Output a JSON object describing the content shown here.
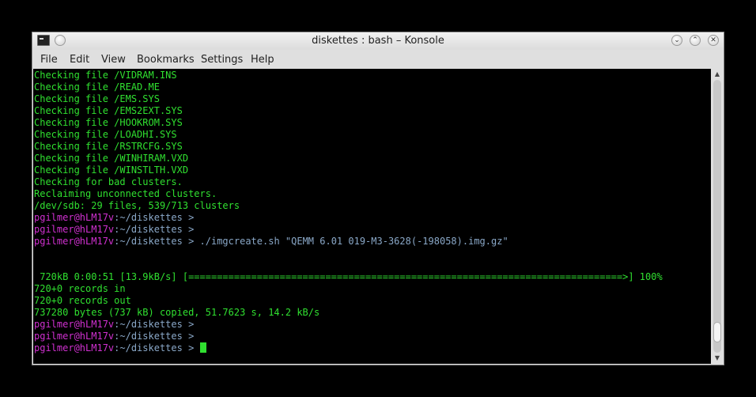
{
  "window": {
    "title": "diskettes : bash – Konsole",
    "controls": [
      "minimize-icon",
      "maximize-icon",
      "close-icon"
    ],
    "keep_above_icon": "circle-icon"
  },
  "menubar": {
    "items": [
      "File",
      "Edit",
      "View",
      "Bookmarks",
      "Settings",
      "Help"
    ]
  },
  "colors": {
    "output": "#30e030",
    "prompt_user": "#d030d0",
    "prompt_path": "#8aa8c8",
    "background": "#000000"
  },
  "terminal": {
    "lines": [
      {
        "text": "Checking file /VIDRAM.INS"
      },
      {
        "text": "Checking file /READ.ME"
      },
      {
        "text": "Checking file /EMS.SYS"
      },
      {
        "text": "Checking file /EMS2EXT.SYS"
      },
      {
        "text": "Checking file /HOOKROM.SYS"
      },
      {
        "text": "Checking file /LOADHI.SYS"
      },
      {
        "text": "Checking file /RSTRCFG.SYS"
      },
      {
        "text": "Checking file /WINHIRAM.VXD"
      },
      {
        "text": "Checking file /WINSTLTH.VXD"
      },
      {
        "text": "Checking for bad clusters."
      },
      {
        "text": "Reclaiming unconnected clusters."
      },
      {
        "text": "/dev/sdb: 29 files, 539/713 clusters"
      },
      {
        "user": "pgilmer@hLM17v",
        "path": ":~/diskettes >",
        "cmd": ""
      },
      {
        "user": "pgilmer@hLM17v",
        "path": ":~/diskettes >",
        "cmd": ""
      },
      {
        "user": "pgilmer@hLM17v",
        "path": ":~/diskettes >",
        "cmd": " ./imgcreate.sh \"QEMM 6.01 019-M3-3628(-198058).img.gz\""
      },
      {
        "text": ""
      },
      {
        "text": ""
      },
      {
        "text": " 720kB 0:00:51 [13.9kB/s] [============================================================================>] 100%"
      },
      {
        "text": "720+0 records in"
      },
      {
        "text": "720+0 records out"
      },
      {
        "text": "737280 bytes (737 kB) copied, 51.7623 s, 14.2 kB/s"
      },
      {
        "user": "pgilmer@hLM17v",
        "path": ":~/diskettes >",
        "cmd": ""
      },
      {
        "user": "pgilmer@hLM17v",
        "path": ":~/diskettes >",
        "cmd": ""
      },
      {
        "user": "pgilmer@hLM17v",
        "path": ":~/diskettes >",
        "cmd": " ",
        "cursor": true
      }
    ]
  },
  "scrollbar": {
    "position": 0.96
  }
}
